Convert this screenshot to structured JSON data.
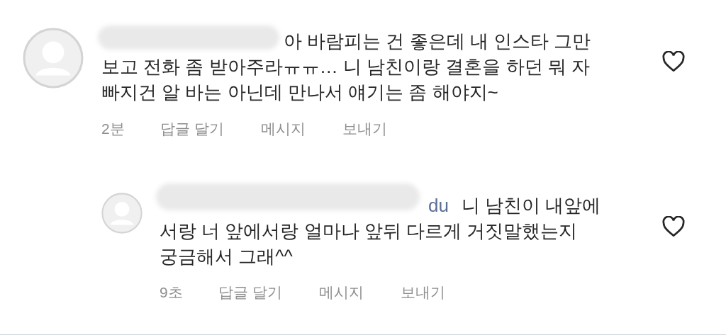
{
  "comments": [
    {
      "kind": "comment",
      "lines": [
        "아 바람피는 건 좋은데 내 인스타 그만",
        "보고 전화 좀 받아주라ㅠㅠ… 니 남친이랑 결혼을 하던 뭐 자",
        "빠지건 알 바는 아닌데 만나서 얘기는 좀 해야지~"
      ],
      "time": "2분",
      "actions": [
        "답글 달기",
        "메시지",
        "보내기"
      ],
      "liked": false
    },
    {
      "kind": "reply",
      "mention": "du",
      "lines": [
        "니 남친이 내앞에",
        "서랑 너 앞에서랑 얼마나 앞뒤 다르게 거짓말했는지",
        "궁금해서 그래^^"
      ],
      "time": "9초",
      "actions": [
        "답글 달기",
        "메시지",
        "보내기"
      ],
      "liked": false
    }
  ]
}
